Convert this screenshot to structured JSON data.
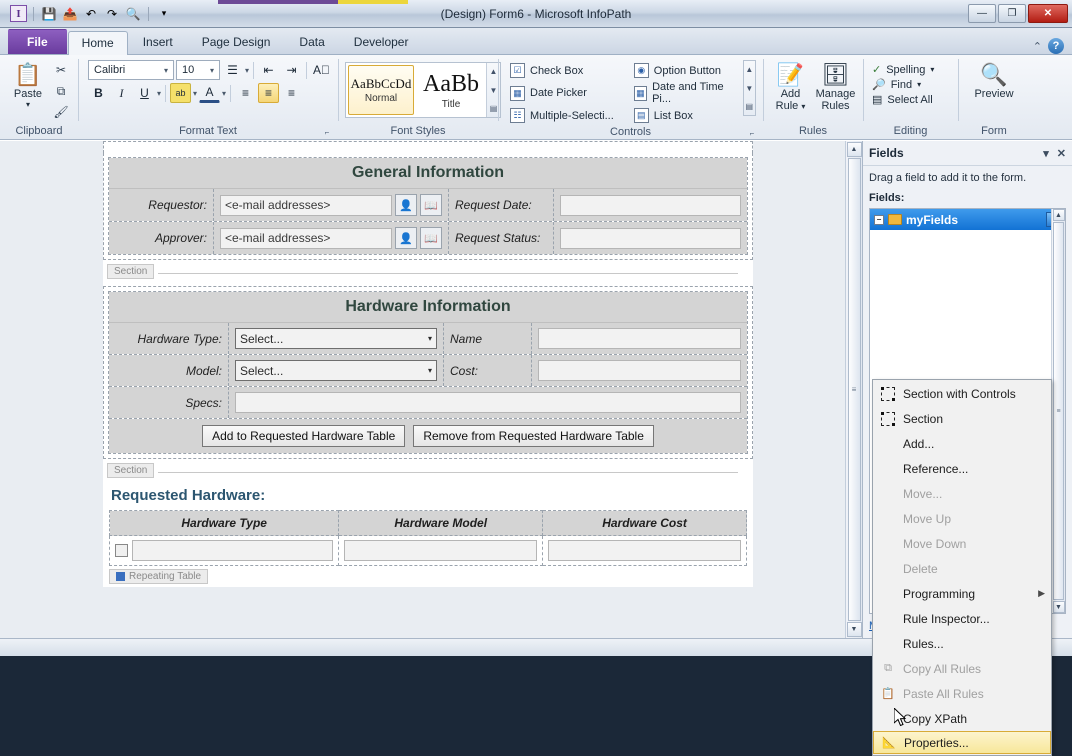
{
  "window": {
    "title": "(Design) Form6 - Microsoft InfoPath",
    "minimize": "—",
    "maximize": "❐",
    "close": "✕"
  },
  "qat": {
    "app_icon": "I",
    "items": [
      {
        "name": "save-icon",
        "glyph": "💾"
      },
      {
        "name": "publish-icon",
        "glyph": "📤"
      },
      {
        "name": "undo-icon",
        "glyph": "↶"
      },
      {
        "name": "redo-icon",
        "glyph": "↷"
      },
      {
        "name": "preview-icon",
        "glyph": "🔍"
      }
    ],
    "customize": "▾"
  },
  "tabs": [
    {
      "label": "File",
      "active": false
    },
    {
      "label": "Home",
      "active": true
    },
    {
      "label": "Insert",
      "active": false
    },
    {
      "label": "Page Design",
      "active": false
    },
    {
      "label": "Data",
      "active": false
    },
    {
      "label": "Developer",
      "active": false
    }
  ],
  "tabbar_right": {
    "minimize_ribbon": "⌃",
    "help": "?"
  },
  "ribbon": {
    "clipboard": {
      "label": "Clipboard",
      "paste": "Paste",
      "paste_arrow": "▾",
      "cut": "✂",
      "copy": "⧉",
      "format_painter": "🖌"
    },
    "format_text": {
      "label": "Format Text",
      "font_name": "Calibri",
      "font_size": "10",
      "bold": "B",
      "italic": "I",
      "underline": "U",
      "highlight": "ab",
      "font_color": "A",
      "bullets": "☰",
      "indent_dec": "⇤",
      "indent_inc": "⇥",
      "clear_format": "A⃠",
      "align_left": "≡",
      "align_center": "≡",
      "align_right": "≡",
      "dialog_launcher": "⌐"
    },
    "font_styles": {
      "label": "Font Styles",
      "items": [
        {
          "sample": "AaBbCcDd",
          "name": "Normal",
          "selected": true
        },
        {
          "sample": "AaBb",
          "name": "Title",
          "selected": false
        }
      ],
      "scroll_up": "▲",
      "scroll_down": "▼",
      "more": "▤"
    },
    "controls": {
      "label": "Controls",
      "items": [
        {
          "label": "Check Box",
          "icon": "☑"
        },
        {
          "label": "Option Button",
          "icon": "◉"
        },
        {
          "label": "Date Picker",
          "icon": "▦"
        },
        {
          "label": "Date and Time Pi...",
          "icon": "▦"
        },
        {
          "label": "Multiple-Selecti...",
          "icon": "☷"
        },
        {
          "label": "List Box",
          "icon": "▤"
        }
      ],
      "scroll_up": "▲",
      "scroll_down": "▼",
      "more": "▤",
      "dialog_launcher": "⌐"
    },
    "rules": {
      "label": "Rules",
      "add_rule": "Add\nRule",
      "add_rule_l1": "Add",
      "add_rule_l2": "Rule",
      "add_rule_arrow": "▾",
      "manage_rules_l1": "Manage",
      "manage_rules_l2": "Rules"
    },
    "editing": {
      "label": "Editing",
      "spelling": "Spelling",
      "spelling_arrow": "▾",
      "find": "Find",
      "find_arrow": "▾",
      "select_all": "Select All"
    },
    "form": {
      "label": "Form",
      "preview": "Preview"
    }
  },
  "form": {
    "general": {
      "heading": "General Information",
      "requestor_label": "Requestor:",
      "requestor_value": "<e-mail addresses>",
      "approver_label": "Approver:",
      "approver_value": "<e-mail addresses>",
      "request_date_label": "Request Date:",
      "request_date_value": "",
      "request_status_label": "Request Status:",
      "request_status_value": "",
      "check_names_icon": "👤",
      "address_book_icon": "📖",
      "date_picker_icon": "▦",
      "section_tag": "Section"
    },
    "hardware": {
      "heading": "Hardware Information",
      "hardware_type_label": "Hardware Type:",
      "hardware_type_value": "Select...",
      "name_label": "Name",
      "name_value": "",
      "model_label": "Model:",
      "model_value": "Select...",
      "cost_label": "Cost:",
      "cost_value": "",
      "specs_label": "Specs:",
      "specs_value": "",
      "add_button": "Add to Requested Hardware Table",
      "remove_button": "Remove from Requested Hardware Table",
      "section_tag": "Section",
      "dropdown_arrow": "▾"
    },
    "requested": {
      "title": "Requested Hardware:",
      "columns": [
        "Hardware Type",
        "Hardware Model",
        "Hardware Cost"
      ],
      "rows": [
        [
          "",
          "",
          ""
        ]
      ],
      "repeating_tag": "Repeating Table"
    }
  },
  "scrollbars": {
    "up_arrow": "▲",
    "down_arrow": "▼",
    "grip": "≡"
  },
  "pane": {
    "title": "Fields",
    "dropdown": "▾",
    "close": "✕",
    "hint": "Drag a field to add it to the form.",
    "fields_label": "Fields:",
    "root_node": "myFields",
    "expander": "−",
    "node_dropdown": "▾",
    "manage_link": "Manage Data Connections..."
  },
  "context_menu": {
    "items": [
      {
        "label": "Section with Controls",
        "icon": "section-icon",
        "disabled": false,
        "highlighted": false,
        "submenu": false
      },
      {
        "label": "Section",
        "icon": "section-icon",
        "disabled": false,
        "highlighted": false,
        "submenu": false
      },
      {
        "label": "Add...",
        "icon": "",
        "disabled": false,
        "highlighted": false,
        "submenu": false
      },
      {
        "label": "Reference...",
        "icon": "",
        "disabled": false,
        "highlighted": false,
        "submenu": false
      },
      {
        "label": "Move...",
        "icon": "",
        "disabled": true,
        "highlighted": false,
        "submenu": false
      },
      {
        "label": "Move Up",
        "icon": "",
        "disabled": true,
        "highlighted": false,
        "submenu": false
      },
      {
        "label": "Move Down",
        "icon": "",
        "disabled": true,
        "highlighted": false,
        "submenu": false
      },
      {
        "label": "Delete",
        "icon": "",
        "disabled": true,
        "highlighted": false,
        "submenu": false
      },
      {
        "label": "Programming",
        "icon": "",
        "disabled": false,
        "highlighted": false,
        "submenu": true
      },
      {
        "label": "Rule Inspector...",
        "icon": "",
        "disabled": false,
        "highlighted": false,
        "submenu": false
      },
      {
        "label": "Rules...",
        "icon": "",
        "disabled": false,
        "highlighted": false,
        "submenu": false
      },
      {
        "label": "Copy All Rules",
        "icon": "copy-icon",
        "disabled": true,
        "highlighted": false,
        "submenu": false
      },
      {
        "label": "Paste All Rules",
        "icon": "paste-icon",
        "disabled": true,
        "highlighted": false,
        "submenu": false
      },
      {
        "label": "Copy XPath",
        "icon": "",
        "disabled": false,
        "highlighted": false,
        "submenu": false
      },
      {
        "label": "Properties...",
        "icon": "properties-icon",
        "disabled": false,
        "highlighted": true,
        "submenu": false
      }
    ],
    "submenu_arrow": "▶"
  },
  "colors": {
    "file_tab": "#6a3c9e",
    "accent_yellow": "#ecd63c",
    "selection_blue": "#1272d4",
    "heading_green": "#30473f",
    "requested_title": "#2c5670",
    "highlight_gold": "#d8ab37"
  }
}
